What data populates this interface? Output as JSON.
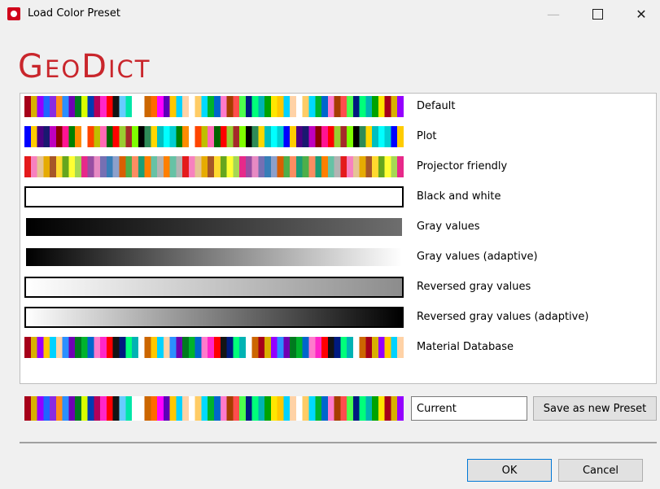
{
  "window": {
    "title": "Load Color Preset",
    "minimize_glyph": "—",
    "close_glyph": "✕"
  },
  "logo": {
    "text_geo_g": "G",
    "text_geo_rest": "EO",
    "text_dict_d": "D",
    "text_dict_rest": "ICT"
  },
  "palettes": {
    "default": [
      "#a6001a",
      "#ffc700",
      "#2b8fff",
      "#00b32c",
      "#ff26c9",
      "#001a80",
      "#ffffff",
      "#d8b000",
      "#00d2ff",
      "#6f00b3",
      "#0066cc",
      "#ff0000",
      "#00ff7a",
      "#cc6600",
      "#9400ff",
      "#ffd2a6",
      "#007a1f",
      "#ff7acc",
      "#141414",
      "#00b3b3",
      "#ff6a00",
      "#1f66ff",
      "#ffffff",
      "#d9ff00",
      "#a63d00",
      "#66ccff",
      "#00a300",
      "#ff00ff",
      "#8a2be2",
      "#ffcc66",
      "#003cb3",
      "#ff4d4d",
      "#00e6a8",
      "#ffe600",
      "#5c00b8",
      "#ff8c1a",
      "#00d9ff",
      "#b30059",
      "#4dff4d",
      "#ffffff"
    ],
    "plot": [
      "#0000ff",
      "#008000",
      "#ff0000",
      "#00bfbf",
      "#bf00bf",
      "#bfbf00",
      "#000000",
      "#ffcc00",
      "#ff8c00",
      "#9acd32",
      "#00ffff",
      "#8b0000",
      "#ff69b4",
      "#2e8b57",
      "#4b0082",
      "#ffffff",
      "#a52a2a",
      "#00ced1",
      "#ff1493",
      "#006400",
      "#ffd700",
      "#191970",
      "#ff4500",
      "#7fff00"
    ],
    "projector": [
      "#e41a1c",
      "#ff7f00",
      "#4daf4a",
      "#377eb8",
      "#984ea3",
      "#ffff33",
      "#a65628",
      "#f781bf",
      "#66c2a5",
      "#fc8d62",
      "#8da0cb",
      "#e78ac3",
      "#a6d854",
      "#ffd92f",
      "#e5c494",
      "#b3b3b3",
      "#1b9e77",
      "#d95f02",
      "#7570b3",
      "#e7298a",
      "#66a61e",
      "#e6ab02"
    ],
    "material": [
      "#a6001a",
      "#ffc700",
      "#2b8fff",
      "#00b32c",
      "#ff26c9",
      "#001a80",
      "#ffffff",
      "#d8b000",
      "#00d2ff",
      "#6f00b3",
      "#0066cc",
      "#ff0000",
      "#00ff7a",
      "#cc6600",
      "#9400ff",
      "#ffd2a6",
      "#007a1f",
      "#ff7acc",
      "#141414",
      "#00b3b3"
    ]
  },
  "presets": [
    {
      "label": "Default",
      "kind": "palette",
      "palette": "default",
      "stripes": 60
    },
    {
      "label": "Plot",
      "kind": "palette",
      "palette": "plot",
      "stripes": 60
    },
    {
      "label": "Projector friendly",
      "kind": "palette",
      "palette": "projector",
      "stripes": 60
    },
    {
      "label": "Black and white",
      "kind": "solid",
      "fill": "#ffffff",
      "border": "#000000"
    },
    {
      "label": "Gray values",
      "kind": "gradient",
      "from": "#000000",
      "to": "#6e6e6e",
      "border": "#ffffff"
    },
    {
      "label": "Gray values (adaptive)",
      "kind": "gradient",
      "from": "#000000",
      "to": "#ffffff",
      "border": "#ffffff"
    },
    {
      "label": "Reversed gray values",
      "kind": "gradient",
      "from": "#ffffff",
      "to": "#8c8c8c",
      "border": "#000000"
    },
    {
      "label": "Reversed gray values (adaptive)",
      "kind": "gradient",
      "from": "#ffffff",
      "to": "#000000",
      "border": "#000000"
    },
    {
      "label": "Material Database",
      "kind": "palette",
      "palette": "material",
      "stripes": 60
    }
  ],
  "current": {
    "palette": "default",
    "stripes": 60
  },
  "name_field": {
    "value": "Current"
  },
  "buttons": {
    "save": "Save as new Preset",
    "ok": "OK",
    "cancel": "Cancel"
  },
  "colors": {
    "logo_red": "#c9262c",
    "ok_border": "#0078d7"
  }
}
